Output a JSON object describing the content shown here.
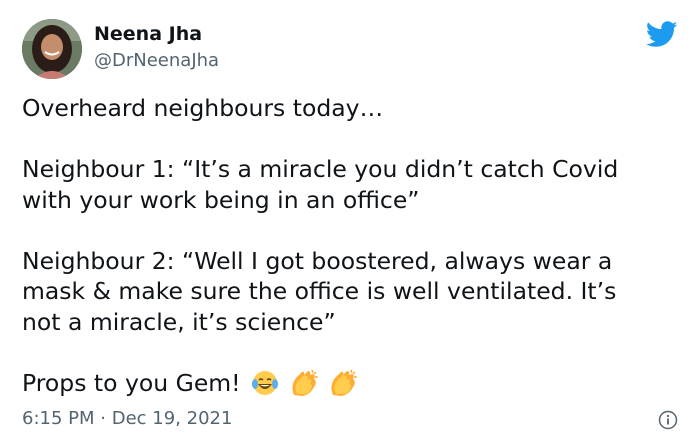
{
  "author": {
    "name": "Neena Jha",
    "handle": "@DrNeenaJha"
  },
  "tweet": {
    "paragraphs": [
      [
        "Overheard neighbours today…"
      ],
      [
        "Neighbour 1: “It’s a miracle you didn’t catch Covid",
        "with your work being in an office”"
      ],
      [
        "Neighbour 2: “Well I got boostered, always wear a",
        "mask & make sure the office is well ventilated. It’s",
        "not a miracle, it’s science”"
      ]
    ],
    "last_line": "Props to you Gem!",
    "emojis": [
      "face-with-tears-of-joy",
      "clapping-hands",
      "clapping-hands"
    ]
  },
  "timestamp": {
    "time": "6:15 PM",
    "separator": "·",
    "date": "Dec 19, 2021"
  },
  "colors": {
    "twitter_blue": "#1d9bf0",
    "secondary_text": "#536471",
    "primary_text": "#0f1419"
  },
  "icons": {
    "brand": "twitter-bird-icon",
    "info": "info-icon"
  }
}
